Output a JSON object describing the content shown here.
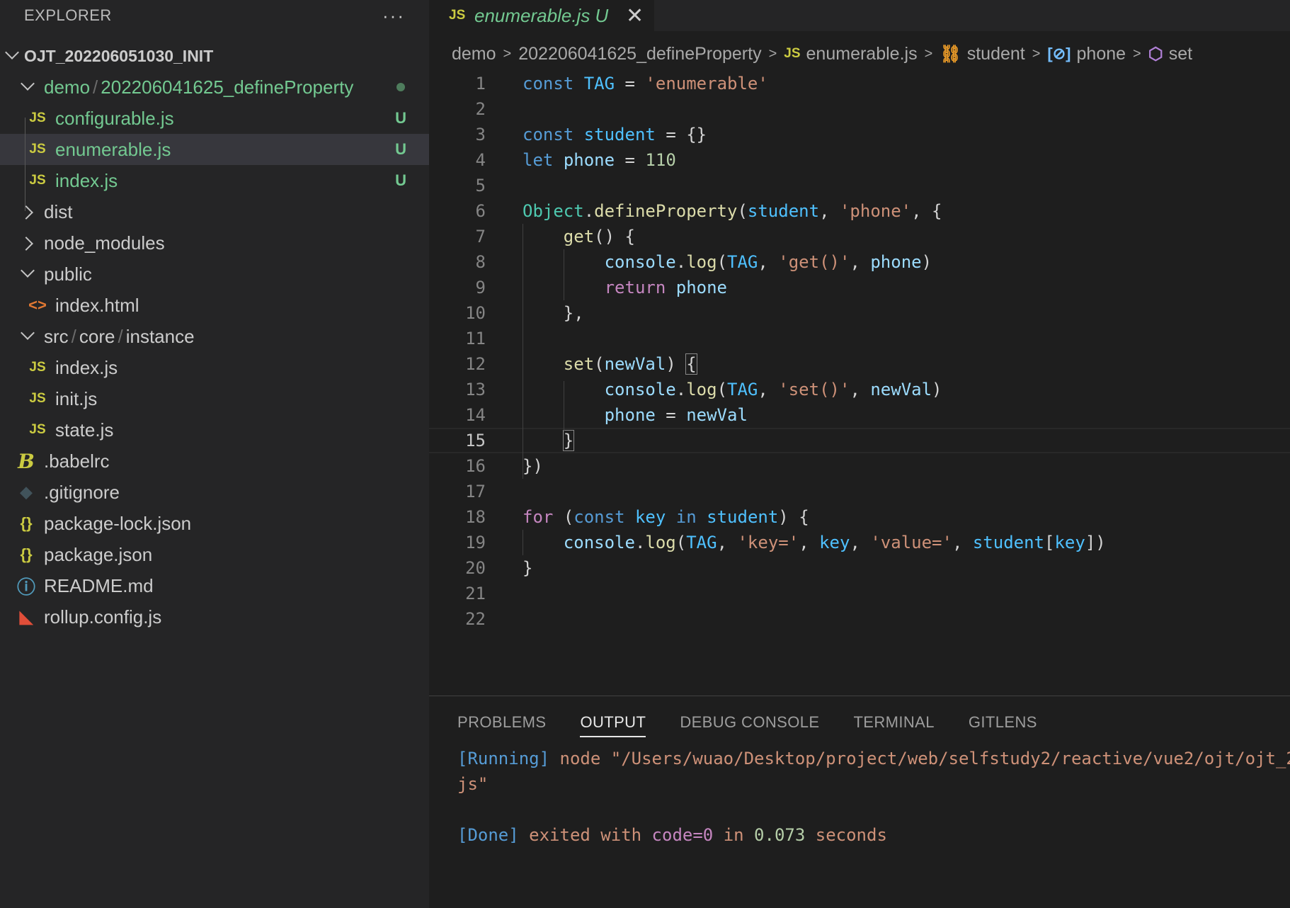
{
  "sidebar": {
    "title": "EXPLORER",
    "more": "···",
    "root": "OJT_202206051030_INIT",
    "demo_folder": {
      "part1": "demo",
      "sep": "/",
      "part2": "202206041625_defineProperty"
    },
    "demo_files": [
      {
        "name": "configurable.js",
        "badge": "U"
      },
      {
        "name": "enumerable.js",
        "badge": "U"
      },
      {
        "name": "index.js",
        "badge": "U"
      }
    ],
    "folders": {
      "dist": "dist",
      "node_modules": "node_modules",
      "public": "public"
    },
    "public_files": [
      "index.html"
    ],
    "src_folder": {
      "p1": "src",
      "sep": "/",
      "p2": "core",
      "p3": "instance"
    },
    "src_files": [
      "index.js",
      "init.js",
      "state.js"
    ],
    "root_files": [
      ".babelrc",
      ".gitignore",
      "package-lock.json",
      "package.json",
      "README.md",
      "rollup.config.js"
    ],
    "js_icon": "JS",
    "html_icon": "<>",
    "json_icon": "{}",
    "info_icon": "ⓘ",
    "babel_icon": "B",
    "git_icon": "◆",
    "rollup_icon": "◣"
  },
  "editor": {
    "tab": {
      "icon": "JS",
      "title": "enumerable.js",
      "badge": "U",
      "close": "✕"
    },
    "breadcrumb": [
      "demo",
      "202206041625_defineProperty",
      "enumerable.js",
      "student",
      "phone",
      "set"
    ],
    "breadcrumb_icons": {
      "file": "JS",
      "object": "⛓",
      "variable": "[⊘]",
      "method": "⬡"
    },
    "line_numbers": [
      "1",
      "2",
      "3",
      "4",
      "5",
      "6",
      "7",
      "8",
      "9",
      "10",
      "11",
      "12",
      "13",
      "14",
      "15",
      "16",
      "17",
      "18",
      "19",
      "20",
      "21",
      "22"
    ],
    "current_line": "15"
  },
  "panel": {
    "tabs": [
      "PROBLEMS",
      "OUTPUT",
      "DEBUG CONSOLE",
      "TERMINAL",
      "GITLENS"
    ],
    "active_tab": "OUTPUT",
    "running_tag": "[Running]",
    "running_cmd": " node \"/Users/wuao/Desktop/project/web/selfstudy2/reactive/vue2/ojt/ojt_2",
    "running_cont": "js\"",
    "done_tag": "[Done]",
    "done_p1": " exited with ",
    "done_code": "code=0",
    "done_p2": " in ",
    "done_time": "0.073",
    "done_p3": " seconds"
  }
}
